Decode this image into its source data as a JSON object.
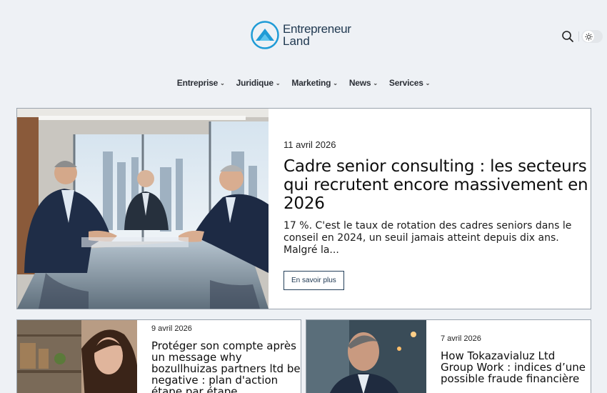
{
  "site": {
    "brand_line1": "Entrepreneur",
    "brand_line2": "Land"
  },
  "header": {
    "search_icon": "search-icon",
    "theme_icon": "sun-icon"
  },
  "nav": {
    "items": [
      {
        "label": "Entreprise"
      },
      {
        "label": "Juridique"
      },
      {
        "label": "Marketing"
      },
      {
        "label": "News"
      },
      {
        "label": "Services"
      }
    ]
  },
  "featured": {
    "date": "11 avril 2026",
    "title": "Cadre senior consulting : les secteurs qui recrutent encore massivement en 2026",
    "excerpt": "17 %. C'est le taux de rotation des cadres seniors dans le conseil en 2024, un seuil jamais atteint depuis dix ans. Malgré la...",
    "button_label": "En savoir plus"
  },
  "cards": [
    {
      "date": "9 avril 2026",
      "title": "Protéger son compte après un message why bozullhuizas partners ltd be negative : plan d'action étape par étape"
    },
    {
      "date": "7 avril 2026",
      "title": "How Tokazavialuz Ltd Group Work : indices d’une possible fraude financière"
    }
  ],
  "colors": {
    "brand": "#1f3850",
    "accent": "#1f9bd6",
    "background": "#eef1f5"
  }
}
